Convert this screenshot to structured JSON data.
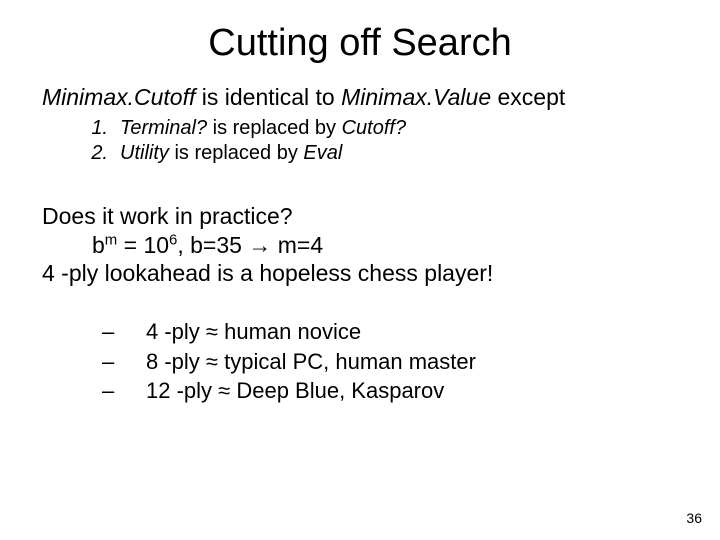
{
  "title": "Cutting off Search",
  "line1": {
    "a": "Minimax.Cutoff",
    "b": " is identical to ",
    "c": "Minimax.Value",
    "d": " except"
  },
  "rules": [
    {
      "n": "1.",
      "parts": {
        "p1": "Terminal?",
        "p2": " is replaced by ",
        "p3": "Cutoff?"
      }
    },
    {
      "n": "2.",
      "parts": {
        "p1": "Utility",
        "p2": " is replaced by ",
        "p3": "Eval"
      }
    }
  ],
  "q": "Does it work in practice?",
  "eq": {
    "b": "b",
    "m": "m",
    "eq1": " = 10",
    "exp": "6",
    "rest": ", b=35 ",
    "arrow": "→",
    "m4": " m=4"
  },
  "hopeless": "4 -ply lookahead is a hopeless chess player!",
  "plys": [
    "4 -ply ≈ human novice",
    "8 -ply ≈ typical PC, human master",
    "12 -ply ≈ Deep Blue, Kasparov"
  ],
  "dash": "–",
  "page": "36"
}
